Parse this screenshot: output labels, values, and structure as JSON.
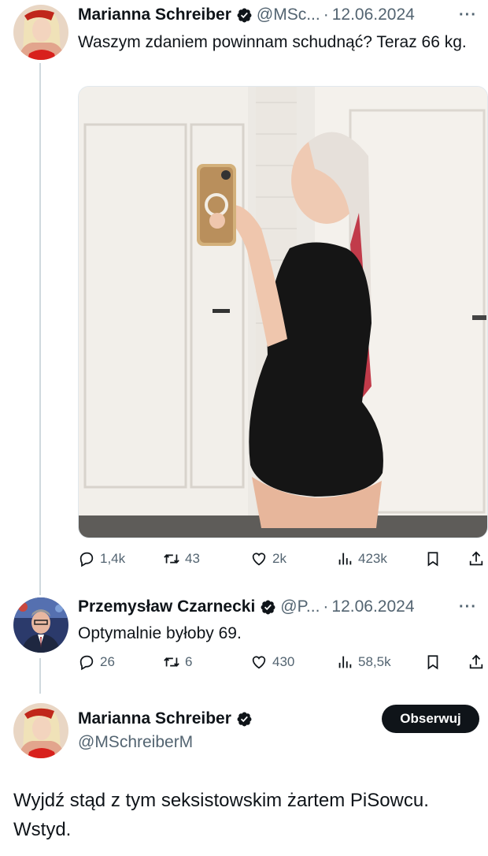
{
  "tweet1": {
    "author_name": "Marianna Schreiber",
    "handle": "@MSc...",
    "separator": "·",
    "date": "12.06.2024",
    "more": "···",
    "text": "Waszym zdaniem powinnam schudnąć? Teraz 66 kg.",
    "stats": {
      "replies": "1,4k",
      "reposts": "43",
      "likes": "2k",
      "views": "423k"
    }
  },
  "tweet2": {
    "author_name": "Przemysław Czarnecki",
    "handle": "@P...",
    "separator": "·",
    "date": "12.06.2024",
    "more": "···",
    "text": "Optymalnie byłoby 69.",
    "stats": {
      "replies": "26",
      "reposts": "6",
      "likes": "430",
      "views": "58,5k"
    }
  },
  "tweet3": {
    "author_name": "Marianna Schreiber",
    "handle": "@MSchreiberM",
    "follow_label": "Obserwuj",
    "text": "Wyjdź stąd z tym seksistowskim żartem PiSowcu. Wstyd."
  },
  "colors": {
    "text_primary": "#0f1419",
    "text_secondary": "#536471",
    "verified_blue": "#1d9bf0",
    "thread_line": "#cfd9de",
    "follow_bg": "#0f1419"
  },
  "icons": [
    "verified-badge-icon",
    "reply-icon",
    "repost-icon",
    "like-icon",
    "views-icon",
    "bookmark-icon",
    "share-icon",
    "more-icon"
  ]
}
